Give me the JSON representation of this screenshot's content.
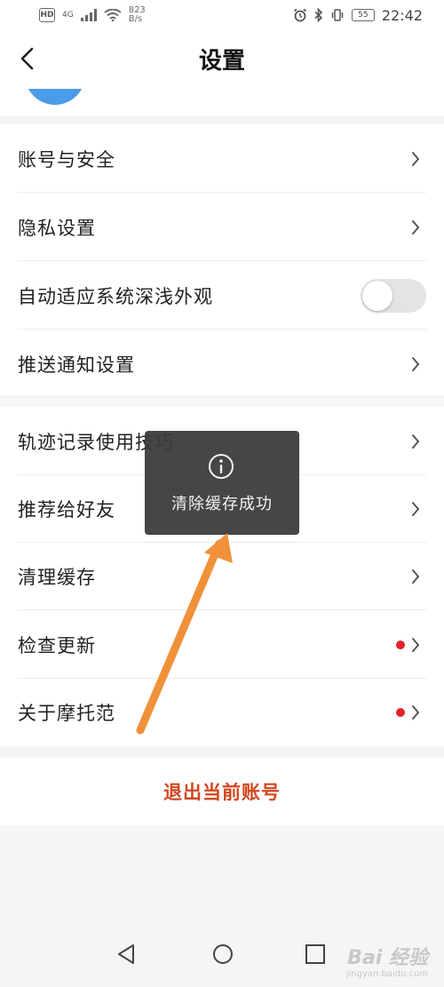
{
  "status_bar": {
    "hd": "HD",
    "net_type": "4G",
    "net_speed_value": "823",
    "net_speed_unit": "B/s",
    "battery": "55",
    "time": "22:42"
  },
  "header": {
    "title": "设置"
  },
  "groups": [
    {
      "items": [
        {
          "label": "账号与安全",
          "control": "chevron"
        },
        {
          "label": "隐私设置",
          "control": "chevron"
        },
        {
          "label": "自动适应系统深浅外观",
          "control": "toggle",
          "toggle_on": false
        },
        {
          "label": "推送通知设置",
          "control": "chevron"
        }
      ]
    },
    {
      "items": [
        {
          "label": "轨迹记录使用技巧",
          "control": "chevron"
        },
        {
          "label": "推荐给好友",
          "control": "chevron"
        },
        {
          "label": "清理缓存",
          "control": "chevron"
        },
        {
          "label": "检查更新",
          "control": "chevron",
          "red_dot": true
        },
        {
          "label": "关于摩托范",
          "control": "chevron",
          "red_dot": true
        }
      ]
    }
  ],
  "logout": {
    "label": "退出当前账号"
  },
  "toast": {
    "icon": "info-icon",
    "message": "清除缓存成功"
  },
  "watermark": {
    "brand": "Bai 经验",
    "url": "jingyan.baidu.com"
  },
  "colors": {
    "accent_logout": "#d2461f",
    "red_dot": "#e0242c",
    "avatar": "#4a9be8",
    "annotation_arrow": "#f0913a"
  }
}
